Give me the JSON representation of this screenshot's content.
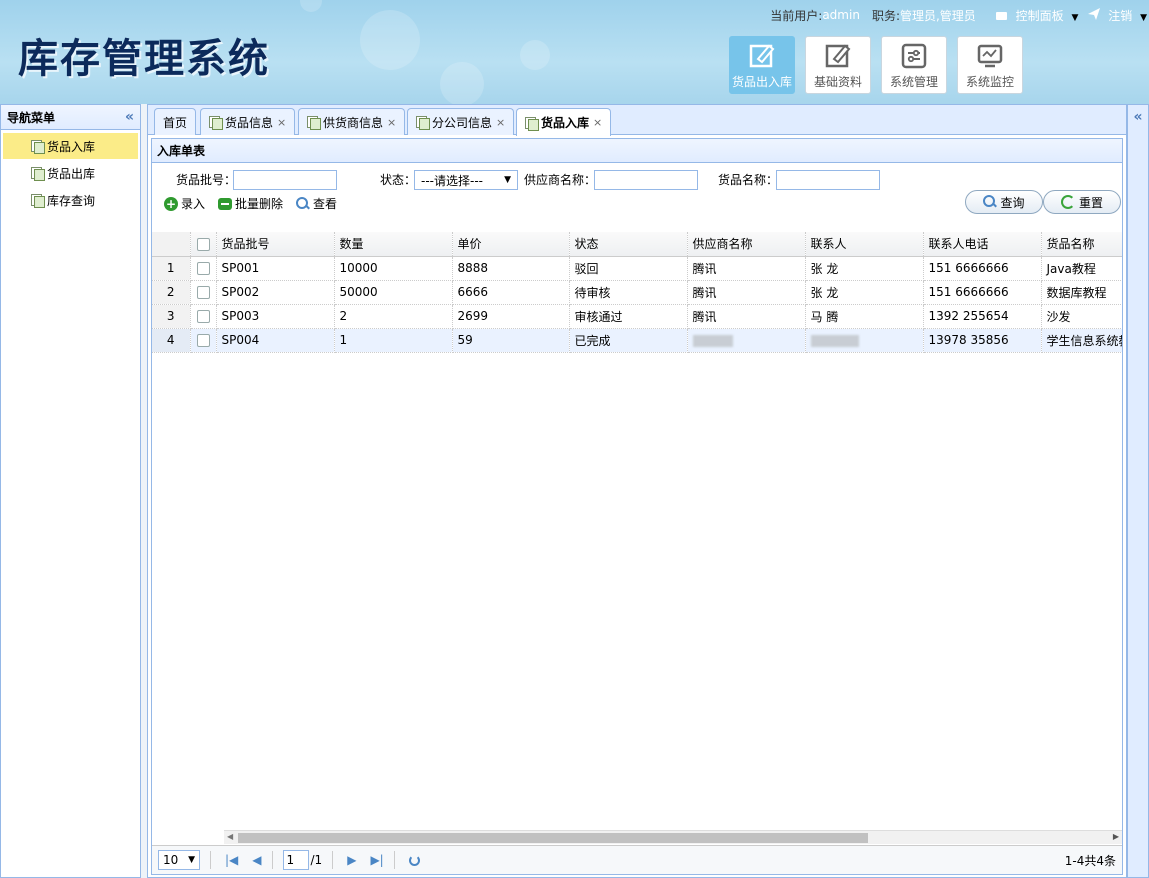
{
  "app": {
    "title": "库存管理系统",
    "userbar": {
      "user_label": "当前用户:",
      "user_value": "admin",
      "role_label": "职务:",
      "role_value": "管理员,管理员",
      "control_panel": "控制面板",
      "logout": "注销"
    },
    "topnav": [
      {
        "label": "货品出入库",
        "icon": "edit-icon",
        "active": true
      },
      {
        "label": "基础资料",
        "icon": "edit-icon",
        "active": false
      },
      {
        "label": "系统管理",
        "icon": "settings-panel-icon",
        "active": false
      },
      {
        "label": "系统监控",
        "icon": "monitor-icon",
        "active": false
      }
    ]
  },
  "sidebar": {
    "title": "导航菜单",
    "items": [
      {
        "label": "货品入库",
        "selected": true
      },
      {
        "label": "货品出库",
        "selected": false
      },
      {
        "label": "库存查询",
        "selected": false
      }
    ]
  },
  "tabs": [
    {
      "label": "首页",
      "closable": false
    },
    {
      "label": "货品信息",
      "closable": true
    },
    {
      "label": "供货商信息",
      "closable": true
    },
    {
      "label": "分公司信息",
      "closable": true
    },
    {
      "label": "货品入库",
      "closable": true,
      "active": true
    }
  ],
  "panel": {
    "title": "入库单表",
    "form": {
      "batch_label": "货品批号：",
      "status_label": "状态：",
      "status_value": "---请选择---",
      "supplier_label": "供应商名称：",
      "goods_label": "货品名称：",
      "search_button": "查询",
      "reset_button": "重置"
    },
    "toolbar": {
      "add": "录入",
      "batch_delete": "批量删除",
      "view": "查看"
    }
  },
  "grid": {
    "columns": [
      "货品批号",
      "数量",
      "单价",
      "状态",
      "供应商名称",
      "联系人",
      "联系人电话",
      "货品名称"
    ],
    "rows": [
      {
        "num": "1",
        "batch": "SP001",
        "qty": "10000",
        "price": "8888",
        "status": "驳回",
        "supplier": "腾讯",
        "contact": "张 龙",
        "phone": "151 6666666",
        "goods": "Java教程"
      },
      {
        "num": "2",
        "batch": "SP002",
        "qty": "50000",
        "price": "6666",
        "status": "待审核",
        "supplier": "腾讯",
        "contact": "张 龙",
        "phone": "151 6666666",
        "goods": "数据库教程"
      },
      {
        "num": "3",
        "batch": "SP003",
        "qty": "2",
        "price": "2699",
        "status": "审核通过",
        "supplier": "腾讯",
        "contact": "马 腾",
        "phone": "1392 255654",
        "goods": "沙发"
      },
      {
        "num": "4",
        "batch": "SP004",
        "qty": "1",
        "price": "59",
        "status": "已完成",
        "supplier": "",
        "contact": "",
        "phone": "13978 35856",
        "goods": "学生信息系统教"
      }
    ]
  },
  "pager": {
    "page_size": "10",
    "current_page": "1",
    "total_pages": "/1",
    "info": "1-4共4条"
  }
}
